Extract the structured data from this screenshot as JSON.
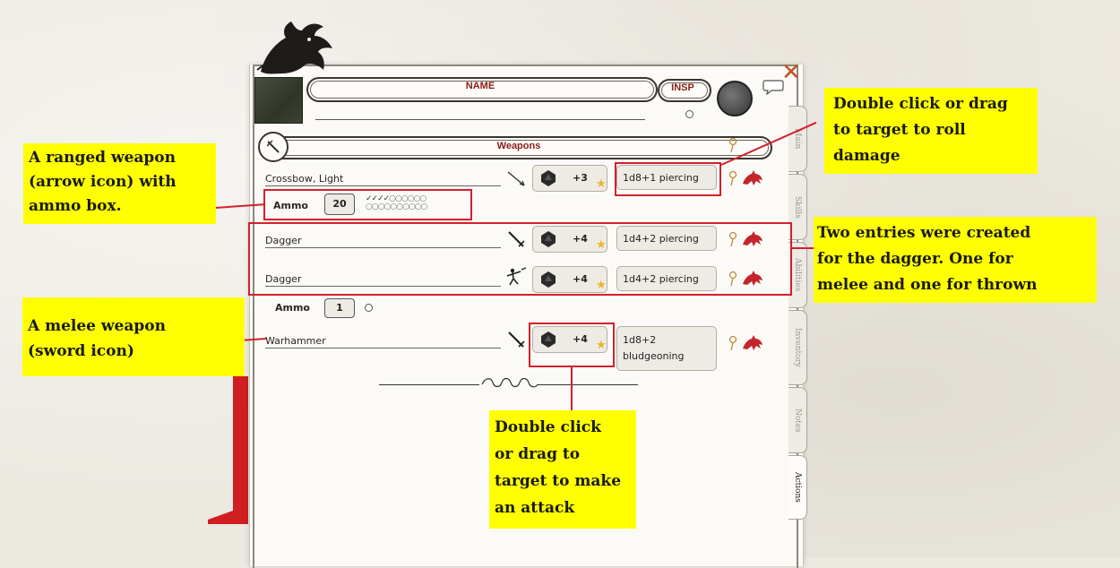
{
  "sheet": {
    "name_label": "NAME",
    "insp_label": "INSP",
    "section_title": "Weapons",
    "side_tabs": [
      "Main",
      "Skills",
      "Abilities",
      "Inventory",
      "Notes",
      "Actions"
    ],
    "active_tab": "Actions"
  },
  "weapons": [
    {
      "name": "Crossbow, Light",
      "type": "ranged",
      "type_icon": "arrow-icon",
      "attack": "+3",
      "damage": "1d8+1 piercing"
    },
    {
      "name": "Dagger",
      "type": "melee",
      "type_icon": "sword-icon",
      "attack": "+4",
      "damage": "1d4+2 piercing"
    },
    {
      "name": "Dagger",
      "type": "thrown",
      "type_icon": "thrown-icon",
      "attack": "+4",
      "damage": "1d4+2 piercing"
    },
    {
      "name": "Warhammer",
      "type": "melee",
      "type_icon": "sword-icon",
      "attack": "+4",
      "damage_line1": "1d8+2",
      "damage_line2": "bludgeoning"
    }
  ],
  "ammo": [
    {
      "label": "Ammo",
      "count": "20"
    },
    {
      "label": "Ammo",
      "count": "1"
    }
  ],
  "callouts": {
    "ranged": [
      "A ranged weapon",
      "(arrow icon) with",
      "ammo box."
    ],
    "melee": [
      "A melee weapon",
      "(sword icon)"
    ],
    "damage": [
      "Double click or drag",
      "to target to roll",
      "damage"
    ],
    "dagger": [
      "Two entries were created",
      "for the dagger. One for",
      "melee and one for thrown"
    ],
    "attack": [
      "Double click",
      "or drag to",
      "target to make",
      "an attack"
    ]
  },
  "colors": {
    "callout_bg": "#ffff00",
    "annotation_red": "#d4202a",
    "header_text": "#8a1c14",
    "roll_icon": "#c3262a"
  }
}
